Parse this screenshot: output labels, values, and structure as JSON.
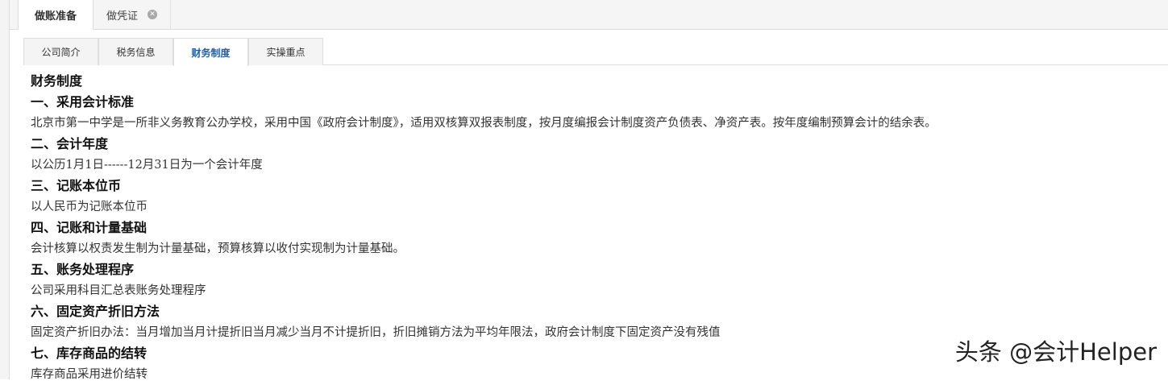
{
  "top_tabs": [
    {
      "label": "做账准备",
      "active": true
    },
    {
      "label": "做凭证",
      "active": false
    }
  ],
  "sub_tabs": [
    {
      "label": "公司简介"
    },
    {
      "label": "税务信息"
    },
    {
      "label": "财务制度"
    },
    {
      "label": "实操重点"
    }
  ],
  "content": {
    "title": "财务制度",
    "sections": [
      {
        "heading": "一、采用会计标准",
        "text": "北京市第一中学是一所非义务教育公办学校，采用中国《政府会计制度》，适用双核算双报表制度，按月度编报会计制度资产负债表、净资产表。按年度编制预算会计的结余表。"
      },
      {
        "heading": "二、会计年度",
        "text": "以公历1月1日------12月31日为一个会计年度"
      },
      {
        "heading": "三、记账本位币",
        "text": "以人民币为记账本位币"
      },
      {
        "heading": "四、记账和计量基础",
        "text": "会计核算以权责发生制为计量基础，预算核算以收付实现制为计量基础。"
      },
      {
        "heading": "五、账务处理程序",
        "text": "公司采用科目汇总表账务处理程序"
      },
      {
        "heading": "六、固定资产折旧方法",
        "text": "固定资产折旧办法：当月增加当月计提折旧当月减少当月不计提折旧，折旧摊销方法为平均年限法，政府会计制度下固定资产没有残值"
      },
      {
        "heading": "七、库存商品的结转",
        "text": "库存商品采用进价结转"
      }
    ]
  },
  "watermark": "头条 @会计Helper",
  "icons": {
    "tab_close": "close-icon"
  }
}
